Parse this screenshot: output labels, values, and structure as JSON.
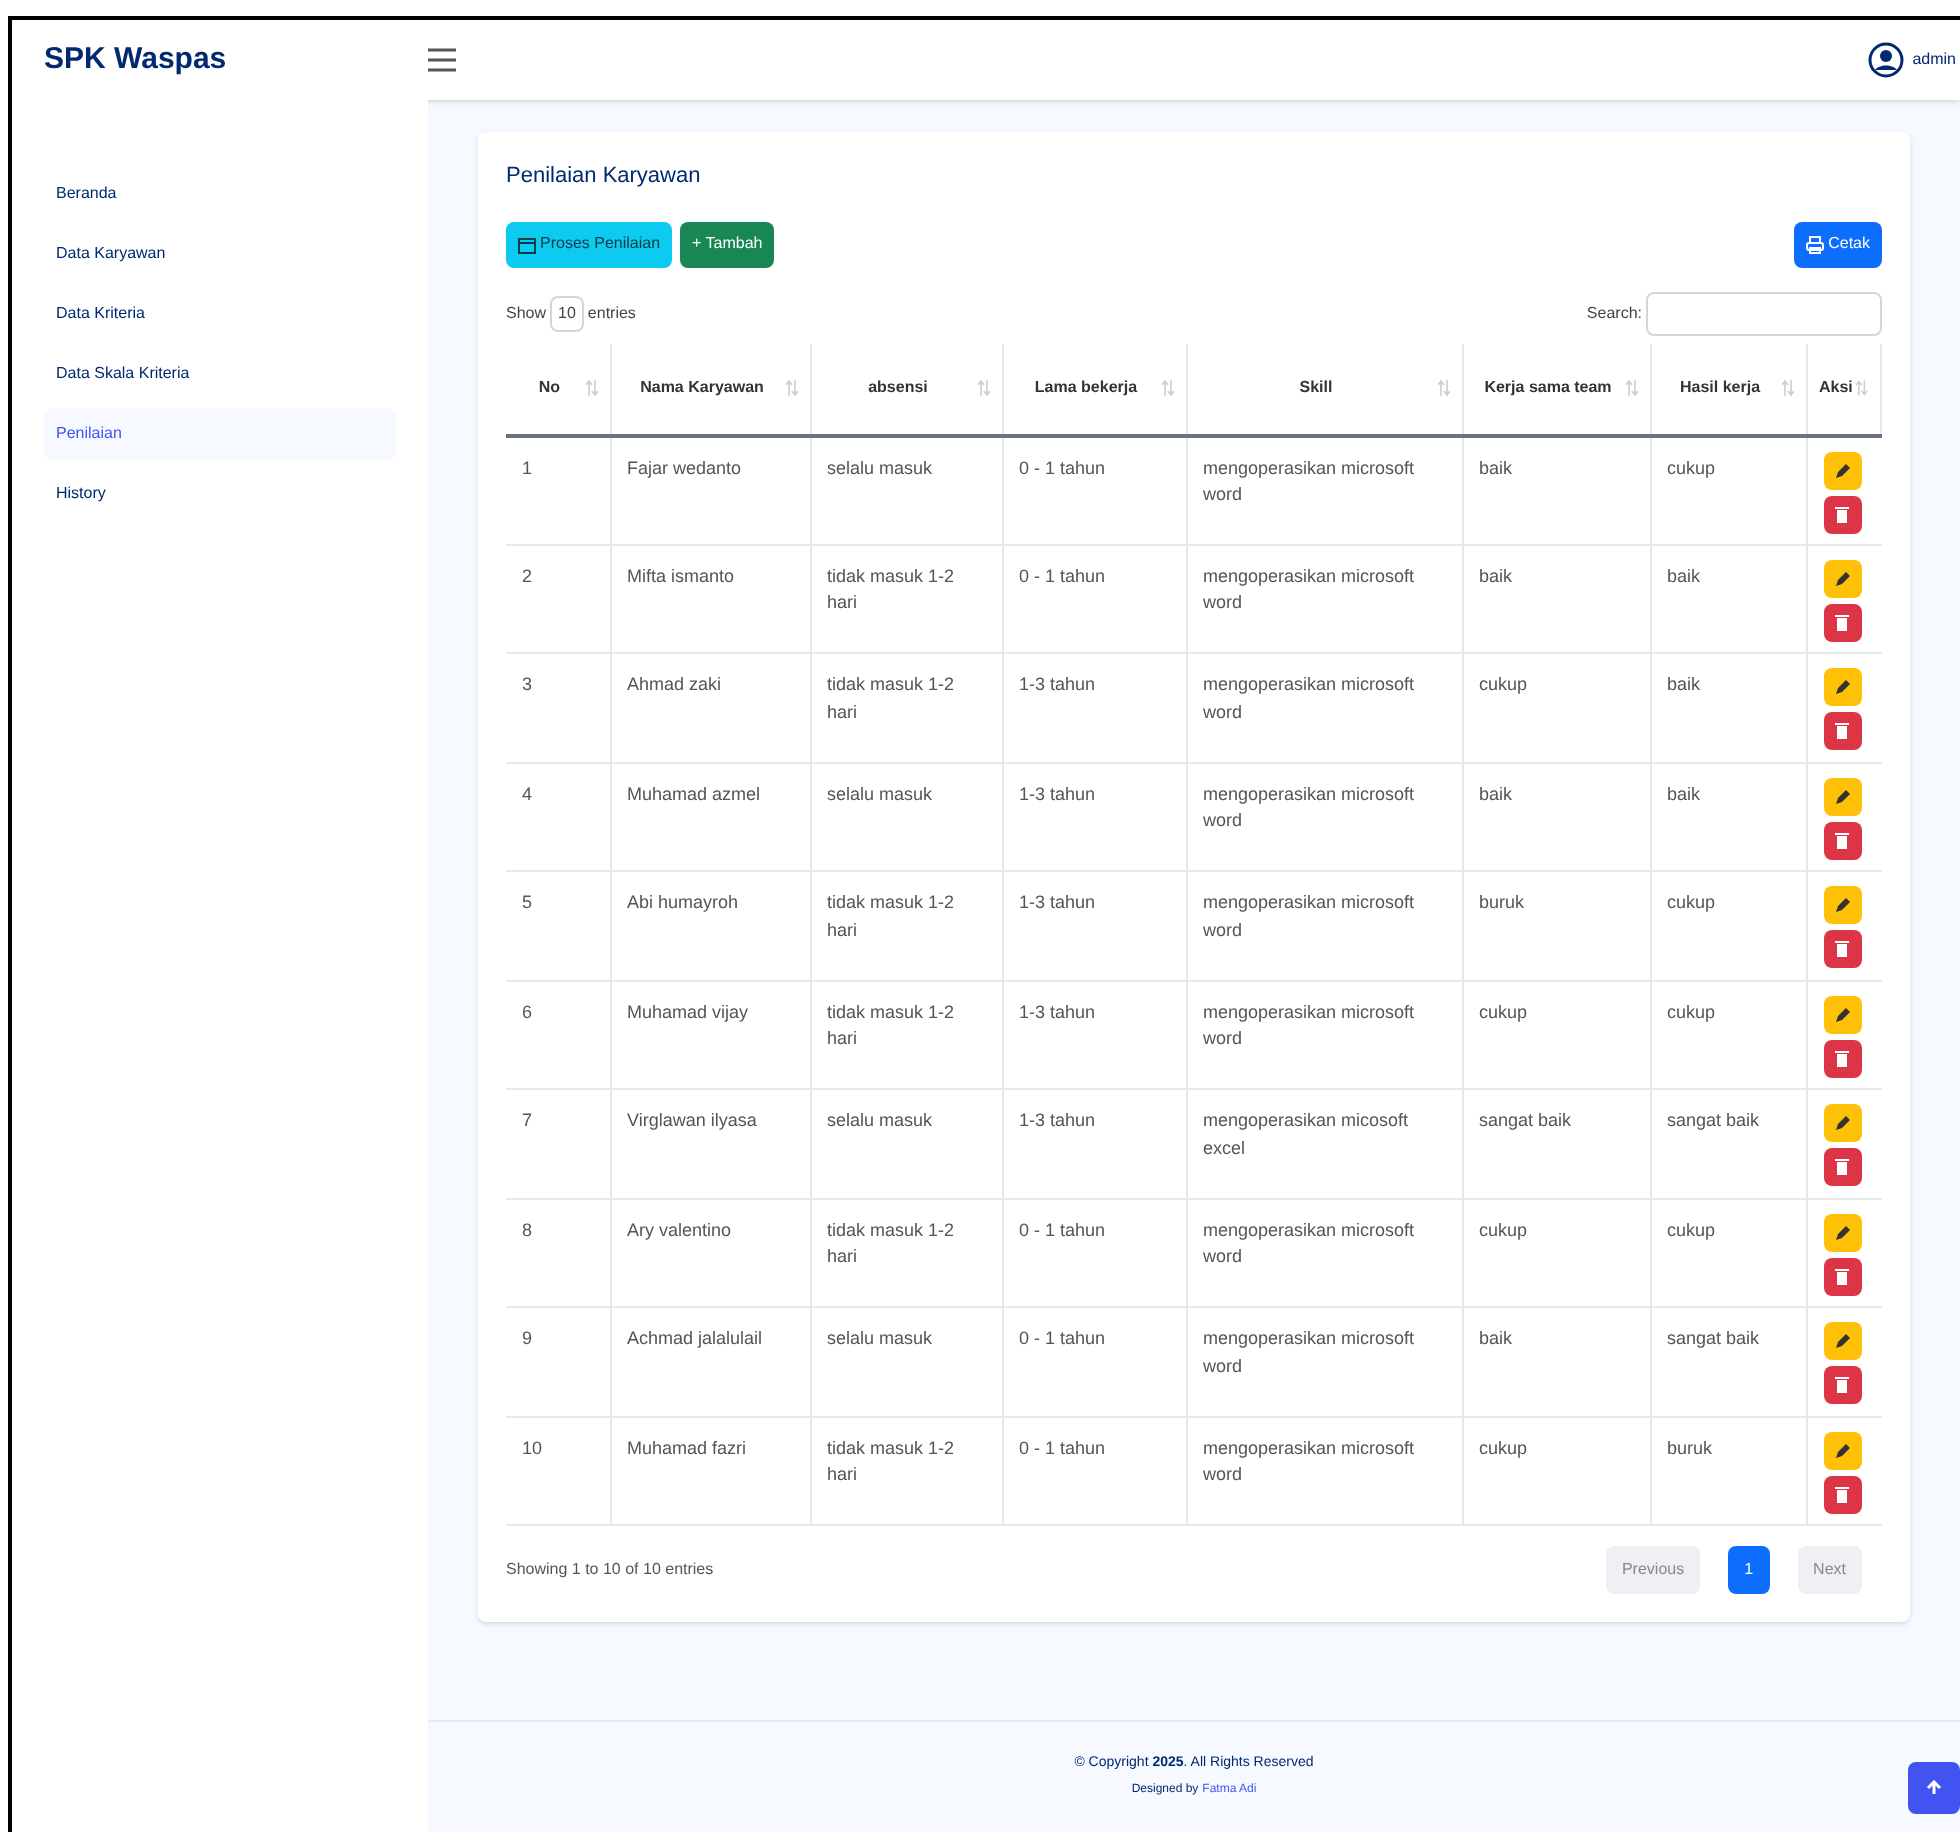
{
  "brand": "SPK Waspas",
  "user": "admin",
  "sidebar": {
    "items": [
      {
        "label": "Beranda",
        "selected": false
      },
      {
        "label": "Data Karyawan",
        "selected": false
      },
      {
        "label": "Data Kriteria",
        "selected": false
      },
      {
        "label": "Data Skala Kriteria",
        "selected": false
      },
      {
        "label": "Penilaian",
        "selected": true
      },
      {
        "label": "History",
        "selected": false
      }
    ]
  },
  "card": {
    "title": "Penilaian Karyawan",
    "buttons": [
      {
        "kind": "process",
        "label": "Proses Penilaian"
      },
      {
        "kind": "add",
        "label": "+ Tambah"
      },
      {
        "kind": "print",
        "label": "Cetak"
      }
    ],
    "length": {
      "before": "Show",
      "value": "10",
      "after": "entries"
    },
    "search": {
      "label": "Search:"
    },
    "table": {
      "columns": [
        "No",
        "Nama Karyawan",
        "absensi",
        "Lama bekerja",
        "Skill",
        "Kerja sama team",
        "Hasil kerja",
        "Aksi"
      ],
      "rows": [
        [
          "1",
          "Fajar wedanto",
          "selalu masuk",
          "0 - 1 tahun",
          "mengoperasikan microsoft word",
          "baik",
          "cukup"
        ],
        [
          "2",
          "Mifta ismanto",
          "tidak masuk 1-2 hari",
          "0 - 1 tahun",
          "mengoperasikan microsoft word",
          "baik",
          "baik"
        ],
        [
          "3",
          "Ahmad zaki",
          "tidak masuk 1-2 hari",
          "1-3 tahun",
          "mengoperasikan microsoft word",
          "cukup",
          "baik"
        ],
        [
          "4",
          "Muhamad azmel",
          "selalu masuk",
          "1-3 tahun",
          "mengoperasikan microsoft word",
          "baik",
          "baik"
        ],
        [
          "5",
          "Abi humayroh",
          "tidak masuk 1-2 hari",
          "1-3 tahun",
          "mengoperasikan microsoft word",
          "buruk",
          "cukup"
        ],
        [
          "6",
          "Muhamad vijay",
          "tidak masuk 1-2 hari",
          "1-3 tahun",
          "mengoperasikan microsoft word",
          "cukup",
          "cukup"
        ],
        [
          "7",
          "Virglawan ilyasa",
          "selalu masuk",
          "1-3 tahun",
          "mengoperasikan micosoft excel",
          "sangat baik",
          "sangat baik"
        ],
        [
          "8",
          "Ary valentino",
          "tidak masuk 1-2 hari",
          "0 - 1 tahun",
          "mengoperasikan microsoft word",
          "cukup",
          "cukup"
        ],
        [
          "9",
          "Achmad jalalulail",
          "selalu masuk",
          "0 - 1 tahun",
          "mengoperasikan microsoft word",
          "baik",
          "sangat baik"
        ],
        [
          "10",
          "Muhamad fazri",
          "tidak masuk 1-2 hari",
          "0 - 1 tahun",
          "mengoperasikan microsoft word",
          "cukup",
          "buruk"
        ]
      ]
    },
    "info": "Showing 1 to 10 of 10 entries",
    "pagination": [
      {
        "label": "Previous",
        "selected": false
      },
      {
        "label": "1",
        "selected": true
      },
      {
        "label": "Next",
        "selected": false
      }
    ]
  },
  "footer": {
    "copyright": "© Copyright **2025**. All Rights Reserved",
    "designed_by": "Designed by",
    "designer": "Fatma Adi"
  }
}
